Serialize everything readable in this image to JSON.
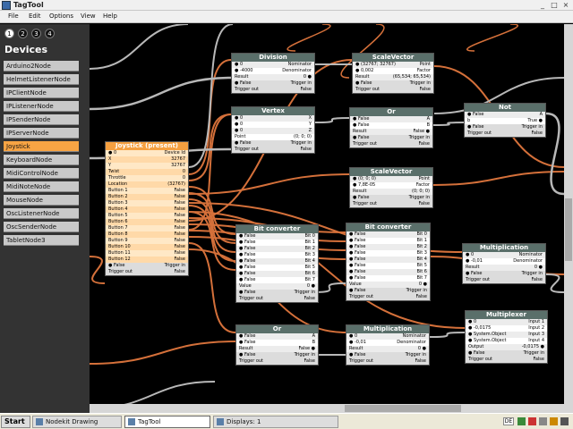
{
  "window": {
    "title": "TagTool"
  },
  "menu": [
    "File",
    "Edit",
    "Options",
    "View",
    "Help"
  ],
  "panel": {
    "tabs": [
      "1",
      "2",
      "3",
      "4"
    ],
    "title": "Devices",
    "devices": [
      "Arduino2Node",
      "HelmetListenerNode",
      "IPClientNode",
      "IPListenerNode",
      "IPSenderNode",
      "IPServerNode",
      "Joystick",
      "KeyboardNode",
      "MidiControlNode",
      "MidiNoteNode",
      "MouseNode",
      "OscListenerNode",
      "OscSenderNode",
      "TabletNode3"
    ],
    "selected_device": "Joystick"
  },
  "nodes": [
    {
      "id": "joystick",
      "title": "Joystick (present)",
      "orange": true,
      "rows": [
        [
          "● 0",
          "Device Id"
        ],
        [
          "X",
          "32767"
        ],
        [
          "Y",
          "32767"
        ],
        [
          "Twist",
          "0"
        ],
        [
          "Throttle",
          "0"
        ],
        [
          "Location",
          "(32767)"
        ],
        [
          "Button 1",
          "False"
        ],
        [
          "Button 2",
          "False"
        ],
        [
          "Button 3",
          "False"
        ],
        [
          "Button 4",
          "False"
        ],
        [
          "Button 5",
          "False"
        ],
        [
          "Button 6",
          "False"
        ],
        [
          "Button 7",
          "False"
        ],
        [
          "Button 8",
          "False"
        ],
        [
          "Button 9",
          "False"
        ],
        [
          "Button 10",
          "False"
        ],
        [
          "Button 11",
          "False"
        ],
        [
          "Button 12",
          "False"
        ],
        [
          "● False",
          "Trigger in"
        ],
        [
          "Trigger out",
          "False"
        ]
      ]
    },
    {
      "id": "division",
      "title": "Division",
      "rows": [
        [
          "● 0",
          "Nominator"
        ],
        [
          "● -4000",
          "Denominator"
        ],
        [
          "Result",
          "0 ●"
        ],
        [
          "● False",
          "Trigger in"
        ],
        [
          "Trigger out",
          "False"
        ]
      ]
    },
    {
      "id": "scalevector1",
      "title": "ScaleVector",
      "rows": [
        [
          "● (32767; 32767)",
          "Point"
        ],
        [
          "● 0,002",
          "Factor"
        ],
        [
          "Result",
          "(65,534; 65,534)"
        ],
        [
          "● False",
          "Trigger in"
        ],
        [
          "Trigger out",
          "False"
        ]
      ]
    },
    {
      "id": "vertex",
      "title": "Vertex",
      "rows": [
        [
          "● 0",
          "X"
        ],
        [
          "● 0",
          "Y"
        ],
        [
          "● 0",
          "Z"
        ],
        [
          "Point",
          "(0; 0; 0)"
        ],
        [
          "● False",
          "Trigger in"
        ],
        [
          "Trigger out",
          "False"
        ]
      ]
    },
    {
      "id": "or1",
      "title": "Or",
      "rows": [
        [
          "● False",
          "A"
        ],
        [
          "● False",
          "B"
        ],
        [
          "Result",
          "False ●"
        ],
        [
          "● False",
          "Trigger in"
        ],
        [
          "Trigger out",
          "False"
        ]
      ]
    },
    {
      "id": "not",
      "title": "Not",
      "rows": [
        [
          "● False",
          "A"
        ],
        [
          "b",
          "True ●"
        ],
        [
          "● False",
          "Trigger in"
        ],
        [
          "Trigger out",
          "False"
        ]
      ]
    },
    {
      "id": "scalevector2",
      "title": "ScaleVector",
      "rows": [
        [
          "● (0; 0; 0)",
          "Point"
        ],
        [
          "● 7,8E-05",
          "Factor"
        ],
        [
          "Result",
          "(0; 0; 0)"
        ],
        [
          "● False",
          "Trigger in"
        ],
        [
          "Trigger out",
          "False"
        ]
      ]
    },
    {
      "id": "bitconv1",
      "title": "Bit converter",
      "rows": [
        [
          "● False",
          "Bit 0"
        ],
        [
          "● False",
          "Bit 1"
        ],
        [
          "● False",
          "Bit 2"
        ],
        [
          "● False",
          "Bit 3"
        ],
        [
          "● False",
          "Bit 4"
        ],
        [
          "● False",
          "Bit 5"
        ],
        [
          "● False",
          "Bit 6"
        ],
        [
          "● False",
          "Bit 7"
        ],
        [
          "Value",
          "0 ●"
        ],
        [
          "● False",
          "Trigger in"
        ],
        [
          "Trigger out",
          "False"
        ]
      ]
    },
    {
      "id": "bitconv2",
      "title": "Bit converter",
      "rows": [
        [
          "● False",
          "Bit 0"
        ],
        [
          "● False",
          "Bit 1"
        ],
        [
          "● False",
          "Bit 2"
        ],
        [
          "● False",
          "Bit 3"
        ],
        [
          "● False",
          "Bit 4"
        ],
        [
          "● False",
          "Bit 5"
        ],
        [
          "● False",
          "Bit 6"
        ],
        [
          "● False",
          "Bit 7"
        ],
        [
          "Value",
          "0 ●"
        ],
        [
          "● False",
          "Trigger in"
        ],
        [
          "Trigger out",
          "False"
        ]
      ]
    },
    {
      "id": "mult1",
      "title": "Multiplication",
      "rows": [
        [
          "● 0",
          "Nominator"
        ],
        [
          "● -0,01",
          "Denominator"
        ],
        [
          "Result",
          "0 ●"
        ],
        [
          "● False",
          "Trigger in"
        ],
        [
          "Trigger out",
          "False"
        ]
      ]
    },
    {
      "id": "or2",
      "title": "Or",
      "rows": [
        [
          "● False",
          "A"
        ],
        [
          "● False",
          "B"
        ],
        [
          "Result",
          "False ●"
        ],
        [
          "● False",
          "Trigger in"
        ],
        [
          "Trigger out",
          "False"
        ]
      ]
    },
    {
      "id": "mult2",
      "title": "Multiplication",
      "rows": [
        [
          "● 0",
          "Nominator"
        ],
        [
          "● -0,01",
          "Denominator"
        ],
        [
          "Result",
          "0 ●"
        ],
        [
          "● False",
          "Trigger in"
        ],
        [
          "Trigger out",
          "False"
        ]
      ]
    },
    {
      "id": "multiplexer",
      "title": "Multiplexer",
      "rows": [
        [
          "● 0",
          "Input 1"
        ],
        [
          "● -0,0175",
          "Input 2"
        ],
        [
          "● System.Object",
          "Input 3"
        ],
        [
          "● System.Object",
          "Input 4"
        ],
        [
          "Output",
          "-0,0175 ●"
        ],
        [
          "● False",
          "Trigger in"
        ],
        [
          "Trigger out",
          "False"
        ]
      ]
    }
  ],
  "taskbar": {
    "start": "Start",
    "items": [
      "Nodekit Drawing",
      "TagTool",
      "Displays: 1"
    ],
    "active": "TagTool",
    "tray": "DE"
  },
  "colors": {
    "canvas": "#000000",
    "panel": "#333333",
    "node_header": "#5a6f6a",
    "selected": "#f7a444",
    "wire_orange": "#d4703a",
    "wire_gray": "#b8b8b8"
  }
}
